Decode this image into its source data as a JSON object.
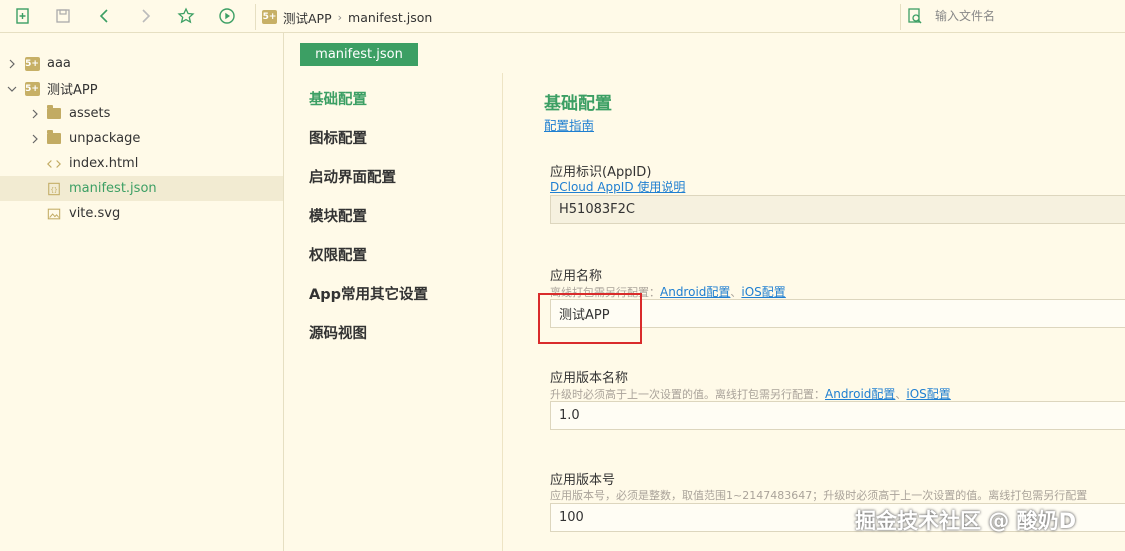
{
  "toolbar": {
    "breadcrumb": {
      "project_badge": "5+",
      "project": "测试APP",
      "file": "manifest.json"
    },
    "search": {
      "placeholder": "输入文件名"
    }
  },
  "tree": {
    "items": [
      {
        "label": "aaa",
        "badge": "5+"
      },
      {
        "label": "测试APP",
        "badge": "5+"
      },
      {
        "label": "assets"
      },
      {
        "label": "unpackage"
      },
      {
        "label": "index.html"
      },
      {
        "label": "manifest.json"
      },
      {
        "label": "vite.svg"
      }
    ]
  },
  "editor": {
    "tab": "manifest.json",
    "nav": [
      "基础配置",
      "图标配置",
      "启动界面配置",
      "模块配置",
      "权限配置",
      "App常用其它设置",
      "源码视图"
    ],
    "section_title": "基础配置",
    "section_link": "配置指南",
    "fields": {
      "appid": {
        "label": "应用标识(AppID)",
        "link": "DCloud AppID 使用说明",
        "value": "H51083F2C"
      },
      "name": {
        "label": "应用名称",
        "desc": "离线打包需另行配置：",
        "android_link": "Android配置",
        "sep": "、",
        "ios_link": "iOS配置",
        "value": "测试APP"
      },
      "version_name": {
        "label": "应用版本名称",
        "desc": "升级时必须高于上一次设置的值。离线打包需另行配置：",
        "android_link": "Android配置",
        "sep": "、",
        "ios_link": "iOS配置",
        "value": "1.0"
      },
      "version_code": {
        "label": "应用版本号",
        "desc": "应用版本号，必须是整数，取值范围1~2147483647；升级时必须高于上一次设置的值。离线打包需另行配置",
        "value": "100"
      }
    }
  },
  "watermark": "掘金技术社区 @ 酸奶D",
  "colors": {
    "accent": "#3c9f64",
    "link": "#1f7fd1",
    "highlight": "#d92b2b",
    "background": "#fffae8"
  }
}
